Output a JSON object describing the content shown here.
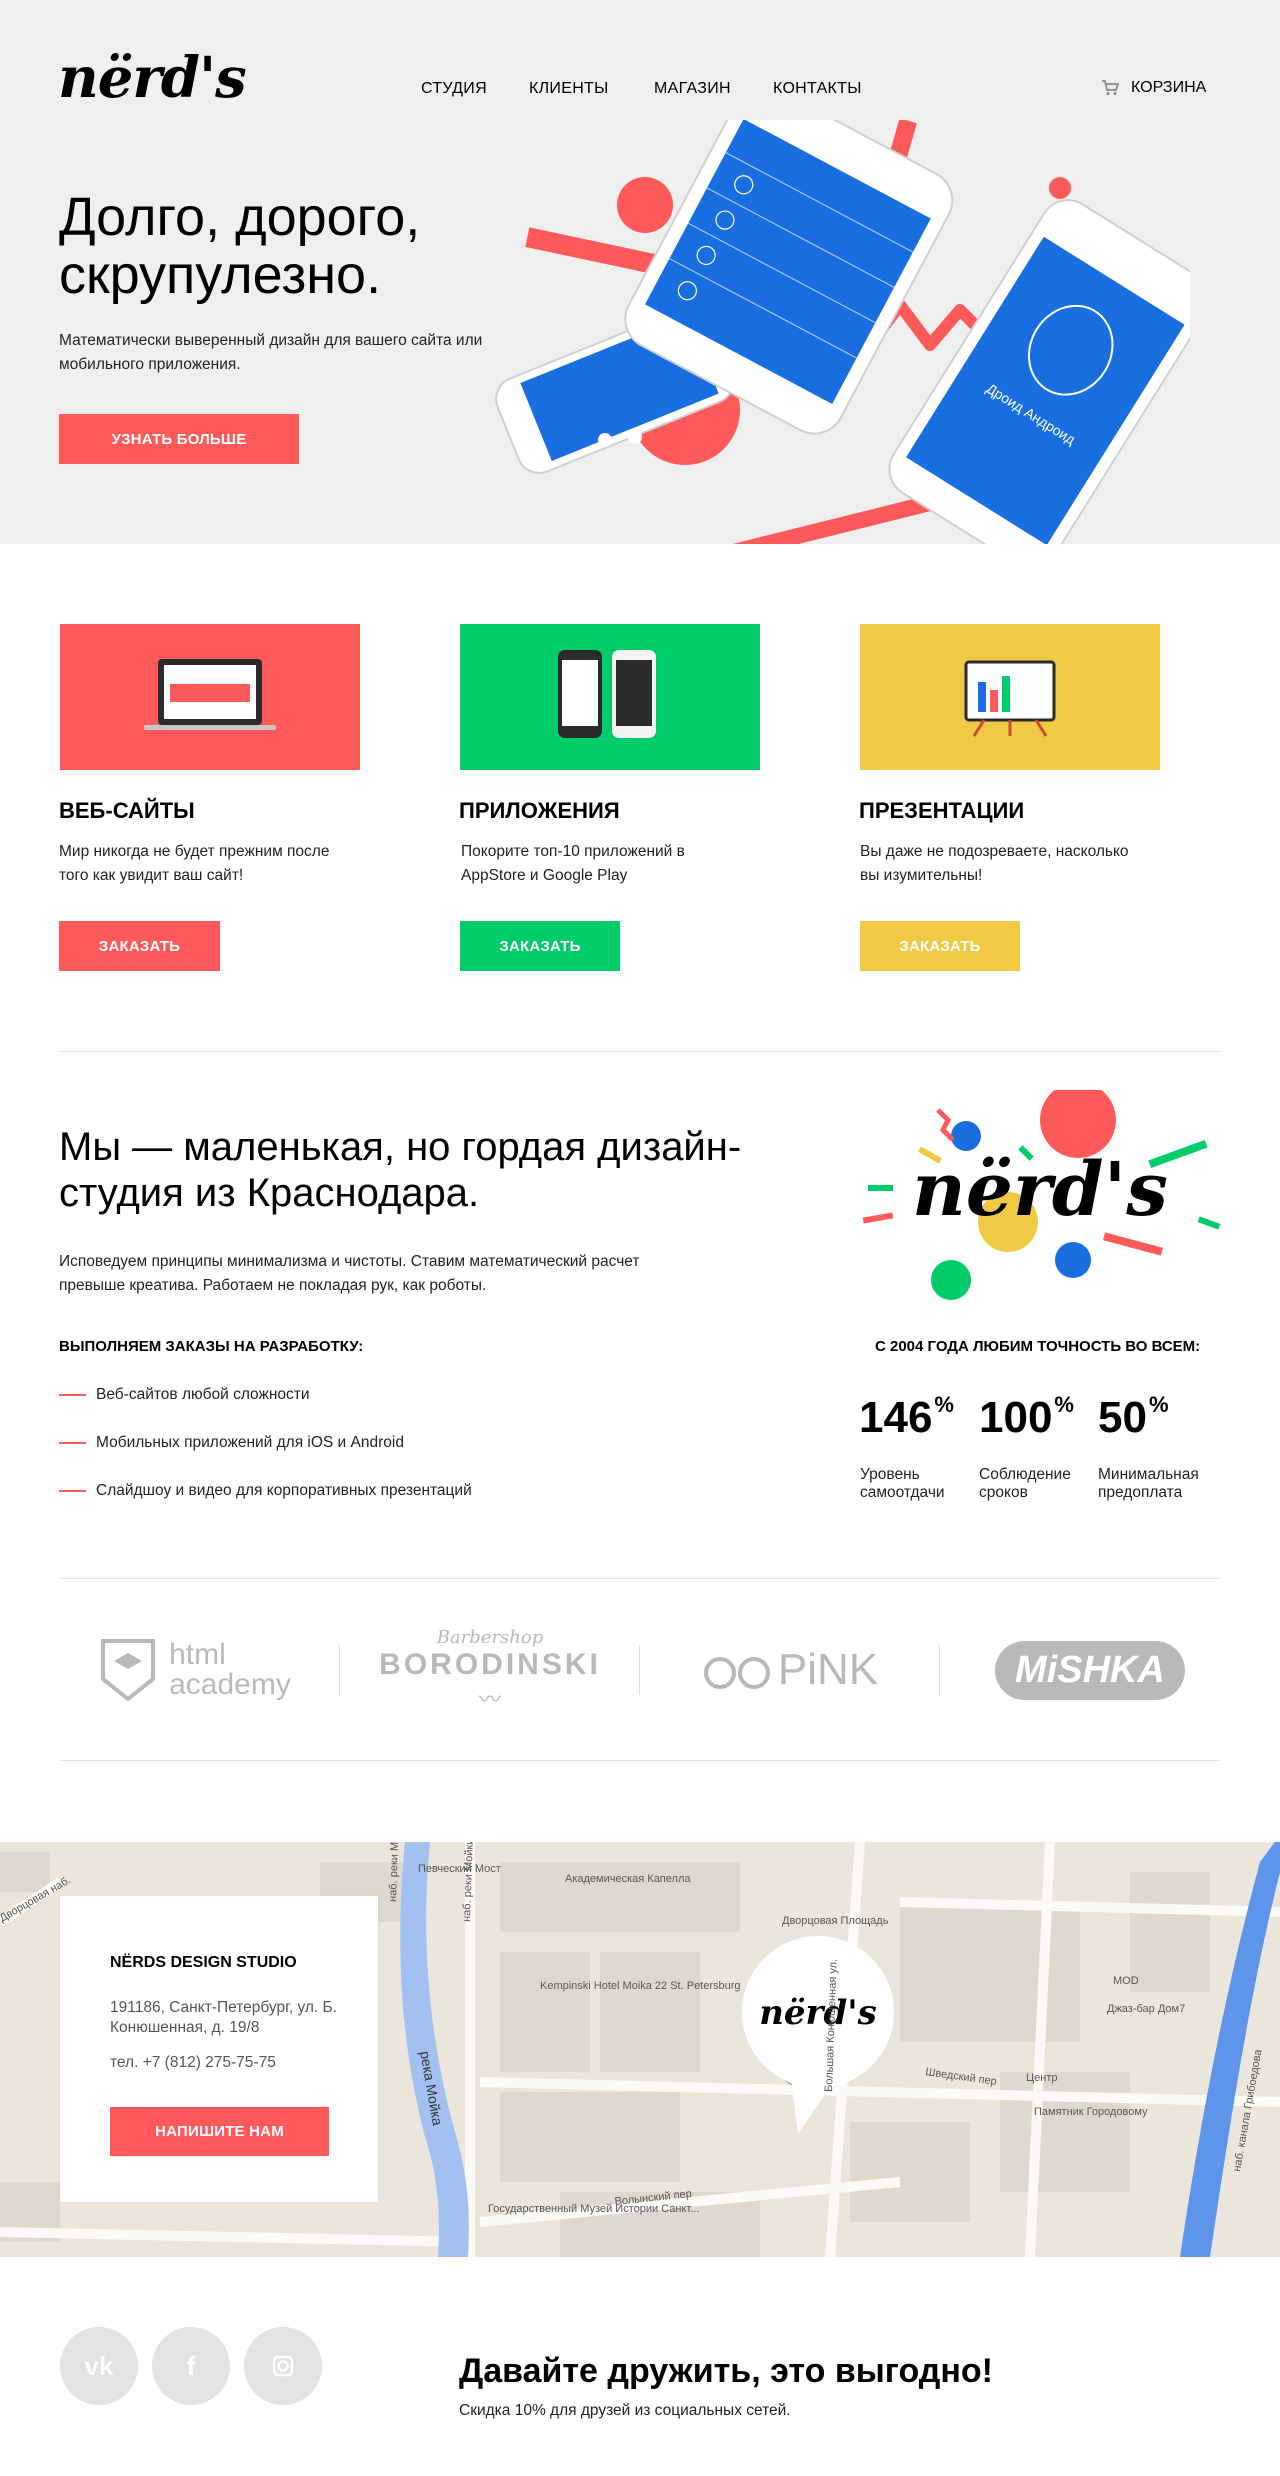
{
  "header": {
    "logo": "nërd's",
    "nav": [
      "СТУДИЯ",
      "КЛИЕНТЫ",
      "МАГАЗИН",
      "КОНТАКТЫ"
    ],
    "cart_label": "КОРЗИНА"
  },
  "hero": {
    "title": "Долго, дорого, скрупулезно.",
    "subtitle": "Математически выверенный дизайн для вашего сайта или мобильного приложения.",
    "button": "УЗНАТЬ БОЛЬШЕ",
    "phone_text": "Дроид Андроид"
  },
  "services": [
    {
      "title": "ВЕБ-САЙТЫ",
      "text": "Мир никогда не будет прежним после того как увидит ваш сайт!",
      "button": "ЗАКАЗАТЬ",
      "color": "#fe5a5a"
    },
    {
      "title": "ПРИЛОЖЕНИЯ",
      "text": "Покорите топ-10 приложений в AppStore и Google Play",
      "button": "ЗАКАЗАТЬ",
      "color": "#00cc6a"
    },
    {
      "title": "ПРЕЗЕНТАЦИИ",
      "text": "Вы даже не подозреваете, насколько вы изумительны!",
      "button": "ЗАКАЗАТЬ",
      "color": "#f0c945"
    }
  ],
  "about": {
    "title": "Мы — маленькая, но гордая дизайн-студия из Краснодара.",
    "text": "Исповедуем принципы минимализма и чистоты. Ставим математический расчет превыше креатива. Работаем не покладая рук, как роботы.",
    "dev_title": "ВЫПОЛНЯЕМ ЗАКАЗЫ НА РАЗРАБОТКУ:",
    "dev_items": [
      "Веб-сайтов любой сложности",
      "Мобильных приложений для iOS и Android",
      "Слайдшоу и видео для корпоративных презентаций"
    ],
    "logo": "nërd's",
    "stats_title": "С 2004 ГОДА ЛЮБИМ ТОЧНОСТЬ ВО ВСЕМ:",
    "stats": [
      {
        "value": "146",
        "unit": "%",
        "label": "Уровень самоотдачи"
      },
      {
        "value": "100",
        "unit": "%",
        "label": "Соблюдение сроков"
      },
      {
        "value": "50",
        "unit": "%",
        "label": "Минимальная предоплата"
      }
    ]
  },
  "partners": {
    "html_academy": [
      "html",
      "academy"
    ],
    "borodinski": [
      "Barbershop",
      "BORODINSKI"
    ],
    "pink": "PiNK",
    "mishka": "MiSHKA"
  },
  "map": {
    "labels": {
      "kapella": "Академическая Капелла",
      "dvortsovaya": "Дворцовая Площадь",
      "kempinski": "Kempinski Hotel Moika 22 St. Petersburg",
      "moika": "река Мойка",
      "naberezhnaya1": "наб. реки Мойки",
      "naberezhnaya2": "наб. реки Мойки",
      "shvedsky": "Шведский пер",
      "volynsky": "Волынский пер",
      "konyushennaya": "Большая Конюшенная ул.",
      "tsentr": "Центр",
      "pamyatnik": "Памятник Городовому",
      "muzey": "Государственный Музей Истории Санкт...",
      "jazz": "Джаз-бар Дом7",
      "mod": "MOD",
      "griboedova": "наб. канала Грибоедова",
      "pevchesky": "Певческий Мост",
      "dvortsovy_left": "Дворцовая наб."
    },
    "pin_logo": "nërd's",
    "card": {
      "title": "NËRDS DESIGN STUDIO",
      "address": "191186, Санкт-Петербург, ул. Б. Конюшенная, д. 19/8",
      "phone": "тел. +7 (812) 275-75-75",
      "button": "НАПИШИТЕ НАМ"
    }
  },
  "footer": {
    "social": [
      "vk",
      "f",
      "ig"
    ],
    "title": "Давайте дружить, это выгодно!",
    "subtitle": "Скидка 10% для друзей из социальных сетей."
  },
  "colors": {
    "red": "#fe5a5a",
    "green": "#00cc6a",
    "yellow": "#f0c945",
    "blue": "#1a6fe0",
    "gray_bg": "#efefef"
  }
}
